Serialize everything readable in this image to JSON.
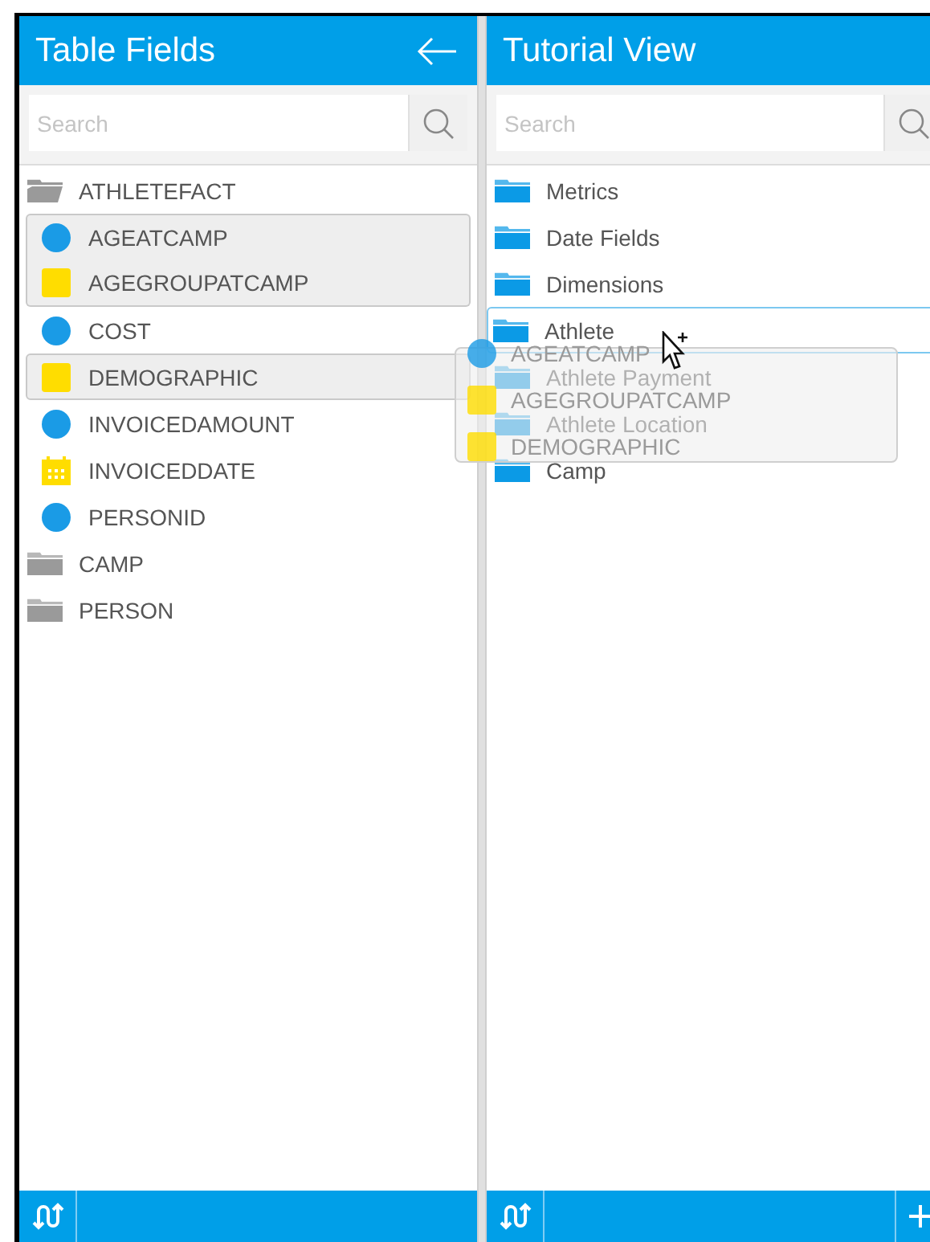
{
  "left_panel": {
    "title": "Table Fields",
    "search": {
      "placeholder": "Search"
    },
    "tree": [
      {
        "label": "ATHLETEFACT",
        "expanded": true,
        "children": [
          {
            "label": "AGEATCAMP",
            "kind": "measure",
            "selected": true
          },
          {
            "label": "AGEGROUPATCAMP",
            "kind": "dimension",
            "selected": true
          },
          {
            "label": "COST",
            "kind": "measure",
            "selected": false
          },
          {
            "label": "DEMOGRAPHIC",
            "kind": "dimension",
            "selected": true
          },
          {
            "label": "INVOICEDAMOUNT",
            "kind": "measure",
            "selected": false
          },
          {
            "label": "INVOICEDDATE",
            "kind": "date",
            "selected": false
          },
          {
            "label": "PERSONID",
            "kind": "measure",
            "selected": false
          }
        ]
      },
      {
        "label": "CAMP",
        "expanded": false
      },
      {
        "label": "PERSON",
        "expanded": false
      }
    ]
  },
  "right_panel": {
    "title": "Tutorial View",
    "search": {
      "placeholder": "Search"
    },
    "folders": [
      {
        "label": "Metrics",
        "drop_target": false
      },
      {
        "label": "Date Fields",
        "drop_target": false
      },
      {
        "label": "Dimensions",
        "drop_target": false
      },
      {
        "label": "Athlete",
        "drop_target": true
      },
      {
        "label": "Athlete Payment",
        "drop_target": false
      },
      {
        "label": "Athlete Location",
        "drop_target": false
      },
      {
        "label": "Camp",
        "drop_target": false
      }
    ]
  },
  "drag_ghost": {
    "items": [
      {
        "label": "AGEATCAMP",
        "kind": "measure"
      },
      {
        "label": "AGEGROUPATCAMP",
        "kind": "dimension"
      },
      {
        "label": "DEMOGRAPHIC",
        "kind": "dimension"
      }
    ]
  }
}
